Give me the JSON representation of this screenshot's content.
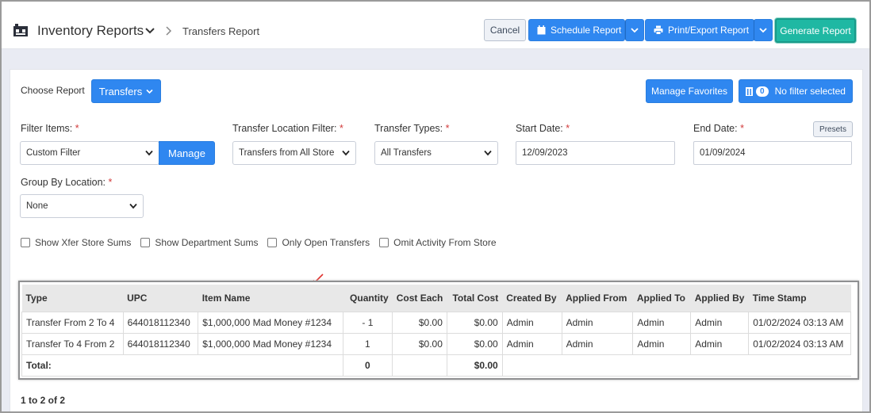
{
  "header": {
    "app_title": "Inventory Reports",
    "breadcrumb": "Transfers Report",
    "cancel_label": "Cancel",
    "schedule_label": "Schedule Report",
    "print_label": "Print/Export Report",
    "generate_label": "Generate Report"
  },
  "toolbar": {
    "choose_report_label": "Choose Report",
    "report_selected": "Transfers",
    "manage_favorites_label": "Manage Favorites",
    "filter_count": "0",
    "no_filter_label": "No filter selected"
  },
  "filters": {
    "filter_items_label": "Filter Items:",
    "filter_items_value": "Custom Filter",
    "manage_label": "Manage",
    "location_filter_label": "Transfer Location Filter:",
    "location_filter_value": "Transfers from All Store",
    "transfer_types_label": "Transfer Types:",
    "transfer_types_value": "All Transfers",
    "start_date_label": "Start Date:",
    "start_date_value": "12/09/2023",
    "end_date_label": "End Date:",
    "end_date_value": "01/09/2024",
    "presets_label": "Presets",
    "group_by_label": "Group By Location:",
    "group_by_value": "None",
    "required_mark": "*"
  },
  "options": [
    {
      "label": "Show Xfer Store Sums",
      "checked": false
    },
    {
      "label": "Show Department Sums",
      "checked": false
    },
    {
      "label": "Only Open Transfers",
      "checked": false
    },
    {
      "label": "Omit Activity From Store",
      "checked": false
    }
  ],
  "table": {
    "columns": [
      "Type",
      "UPC",
      "Item Name",
      "Quantity",
      "Cost Each",
      "Total Cost",
      "Created By",
      "Applied From",
      "Applied To",
      "Applied By",
      "Time Stamp"
    ],
    "rows": [
      [
        "Transfer From 2 To 4",
        "644018112340",
        "$1,000,000 Mad Money #1234",
        "- 1",
        "$0.00",
        "$0.00",
        "Admin",
        "Admin",
        "Admin",
        "Admin",
        "01/02/2024 03:13 AM"
      ],
      [
        "Transfer To 4 From 2",
        "644018112340",
        "$1,000,000 Mad Money #1234",
        "1",
        "$0.00",
        "$0.00",
        "Admin",
        "Admin",
        "Admin",
        "Admin",
        "01/02/2024 03:13 AM"
      ]
    ],
    "total_label": "Total:",
    "total_quantity": "0",
    "total_cost": "$0.00"
  },
  "pager": "1 to 2 of 2",
  "colors": {
    "primary": "#2f87f0",
    "generate": "#1fb8a3",
    "required": "#d23b3b",
    "annotation_arrow": "#e0332f"
  }
}
